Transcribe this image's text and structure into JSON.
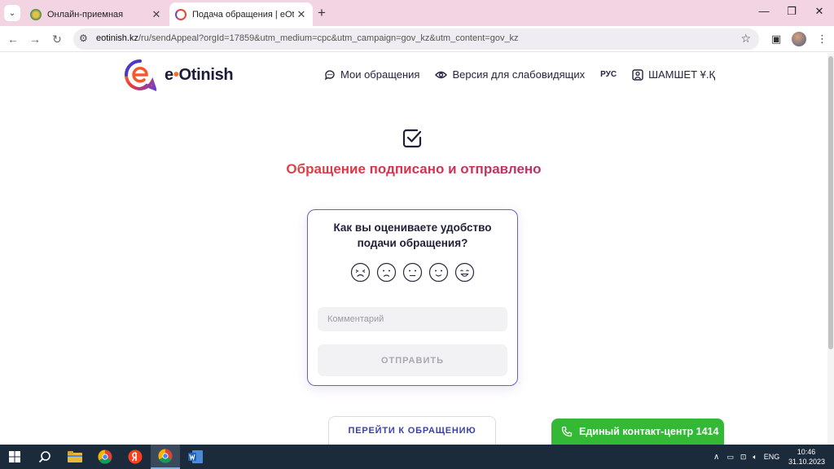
{
  "browser": {
    "tabs": [
      {
        "title": "Онлайн-приемная",
        "active": false
      },
      {
        "title": "Подача обращения | eOtinish",
        "active": true
      }
    ],
    "url_host": "eotinish.kz",
    "url_path": "/ru/sendAppeal?orgId=17859&utm_medium=cpc&utm_campaign=gov_kz&utm_content=gov_kz"
  },
  "header": {
    "logo_prefix": "e",
    "logo_dot": "•",
    "logo_name": "Otinish",
    "nav": {
      "my_appeals": "Мои обращения",
      "accessibility": "Версия для слабовидящих",
      "language": "РУС",
      "user": "ШАМШЕТ Ұ.Қ"
    }
  },
  "main": {
    "title": "Обращение подписано и отправлено",
    "rating_card": {
      "question": "Как вы оцениваете удобство подачи обращения?",
      "ratings": [
        "very-bad",
        "bad",
        "neutral",
        "good",
        "very-good"
      ],
      "comment_placeholder": "Комментарий",
      "submit_label": "ОТПРАВИТЬ"
    },
    "goto_label": "ПЕРЕЙТИ К ОБРАЩЕНИЮ",
    "contact_label": "Единый контакт-центр 1414"
  },
  "taskbar": {
    "language": "ENG",
    "time": "10:46",
    "date": "31.10.2023"
  },
  "colors": {
    "accent": "#6b5bd6",
    "title_gradient_start": "#ef6a2b",
    "title_gradient_end": "#8b2d8e",
    "contact_green": "#33b936",
    "link_blue": "#3b3fb5"
  }
}
